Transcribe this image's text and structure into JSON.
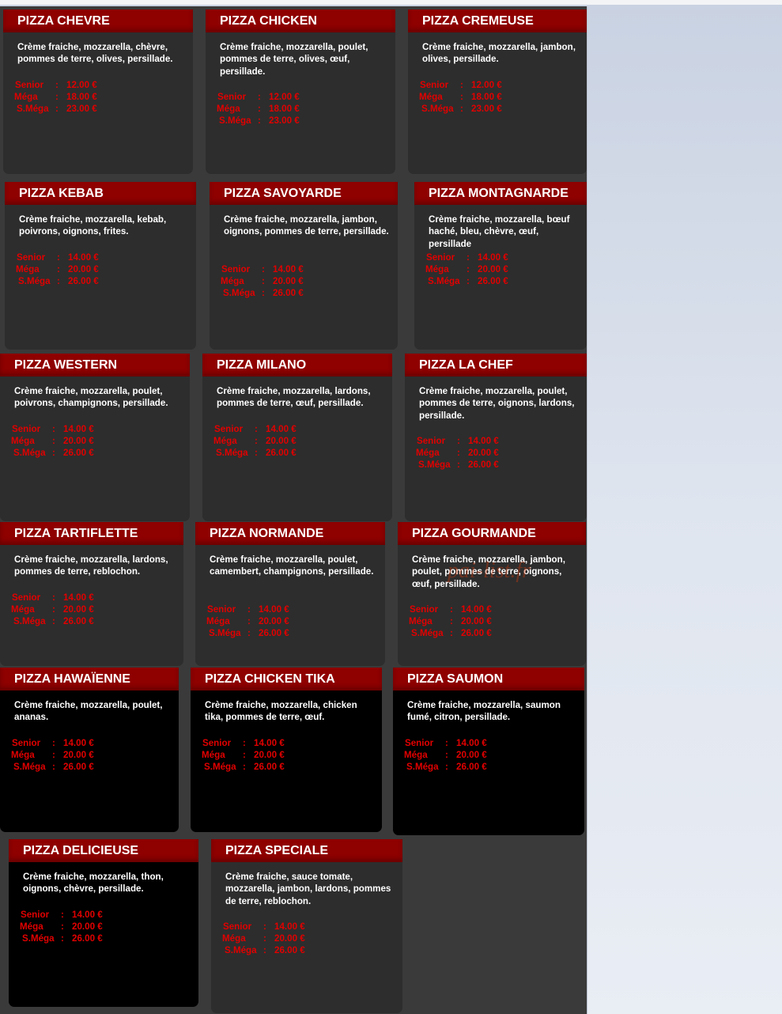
{
  "size_labels": {
    "senior": "Senior",
    "mega": "Méga",
    "smega": "S.Méga",
    "sep": ":"
  },
  "watermark": "pai-list.fr",
  "pizzas": [
    {
      "name": "PIZZA CHEVRE",
      "desc": "Crème fraiche, mozzarella, chèvre, pommes de terre, olives, persillade.",
      "senior": "12.00 €",
      "mega": "18.00 €",
      "smega": "23.00 €"
    },
    {
      "name": "PIZZA CHICKEN",
      "desc": "Crème fraiche, mozzarella, poulet, pommes de terre, olives, œuf, persillade.",
      "senior": "12.00 €",
      "mega": "18.00 €",
      "smega": "23.00 €"
    },
    {
      "name": "PIZZA CREMEUSE",
      "desc": "Crème fraiche, mozzarella, jambon, olives, persillade.",
      "senior": "12.00 €",
      "mega": "18.00 €",
      "smega": "23.00 €"
    },
    {
      "name": "PIZZA KEBAB",
      "desc": "Crème fraiche, mozzarella, kebab, poivrons, oignons, frites.",
      "senior": "14.00 €",
      "mega": "20.00 €",
      "smega": "26.00 €"
    },
    {
      "name": "PIZZA SAVOYARDE",
      "desc": "Crème fraiche, mozzarella, jambon, oignons, pommes de terre, persillade.",
      "senior": "14.00 €",
      "mega": "20.00 €",
      "smega": "26.00 €"
    },
    {
      "name": "PIZZA MONTAGNARDE",
      "desc": "Crème fraiche, mozzarella, bœuf haché, bleu, chèvre, œuf, persillade",
      "senior": "14.00 €",
      "mega": "20.00 €",
      "smega": "26.00 €"
    },
    {
      "name": "PIZZA WESTERN",
      "desc": "Crème fraiche, mozzarella, poulet, poivrons, champignons, persillade.",
      "senior": "14.00 €",
      "mega": "20.00 €",
      "smega": "26.00 €"
    },
    {
      "name": "PIZZA MILANO",
      "desc": "Crème fraiche, mozzarella, lardons, pommes de terre, œuf, persillade.",
      "senior": "14.00 €",
      "mega": "20.00 €",
      "smega": "26.00 €"
    },
    {
      "name": "PIZZA LA CHEF",
      "desc": "Crème fraiche, mozzarella, poulet, pommes de terre, oignons, lardons, persillade.",
      "senior": "14.00 €",
      "mega": "20.00 €",
      "smega": "26.00 €"
    },
    {
      "name": "PIZZA TARTIFLETTE",
      "desc": "Crème fraiche, mozzarella, lardons, pommes de terre, reblochon.",
      "senior": "14.00 €",
      "mega": "20.00 €",
      "smega": "26.00 €"
    },
    {
      "name": "PIZZA NORMANDE",
      "desc": "Crème fraiche, mozzarella, poulet, camembert, champignons, persillade.",
      "senior": "14.00 €",
      "mega": "20.00 €",
      "smega": "26.00 €"
    },
    {
      "name": "PIZZA GOURMANDE",
      "desc": "Crème fraiche, mozzarella, jambon, poulet, pommes de terre, oignons, œuf, persillade.",
      "senior": "14.00 €",
      "mega": "20.00 €",
      "smega": "26.00 €"
    },
    {
      "name": "PIZZA HAWAÏENNE",
      "desc": "Crème fraiche, mozzarella, poulet, ananas.",
      "senior": "14.00 €",
      "mega": "20.00 €",
      "smega": "26.00 €"
    },
    {
      "name": "PIZZA CHICKEN TIKA",
      "desc": "Crème fraiche, mozzarella, chicken tika, pommes de terre, œuf.",
      "senior": "14.00 €",
      "mega": "20.00 €",
      "smega": "26.00 €"
    },
    {
      "name": "PIZZA SAUMON",
      "desc": "Crème fraiche, mozzarella, saumon fumé, citron, persillade.",
      "senior": "14.00 €",
      "mega": "20.00 €",
      "smega": "26.00 €"
    },
    {
      "name": "PIZZA DELICIEUSE",
      "desc": "Crème fraiche, mozzarella, thon, oignons, chèvre, persillade.",
      "senior": "14.00 €",
      "mega": "20.00 €",
      "smega": "26.00 €"
    },
    {
      "name": "PIZZA SPECIALE",
      "desc": "Crème fraiche, sauce tomate, mozzarella, jambon, lardons, pommes de terre, reblochon.",
      "senior": "14.00 €",
      "mega": "20.00 €",
      "smega": "26.00 €"
    }
  ]
}
